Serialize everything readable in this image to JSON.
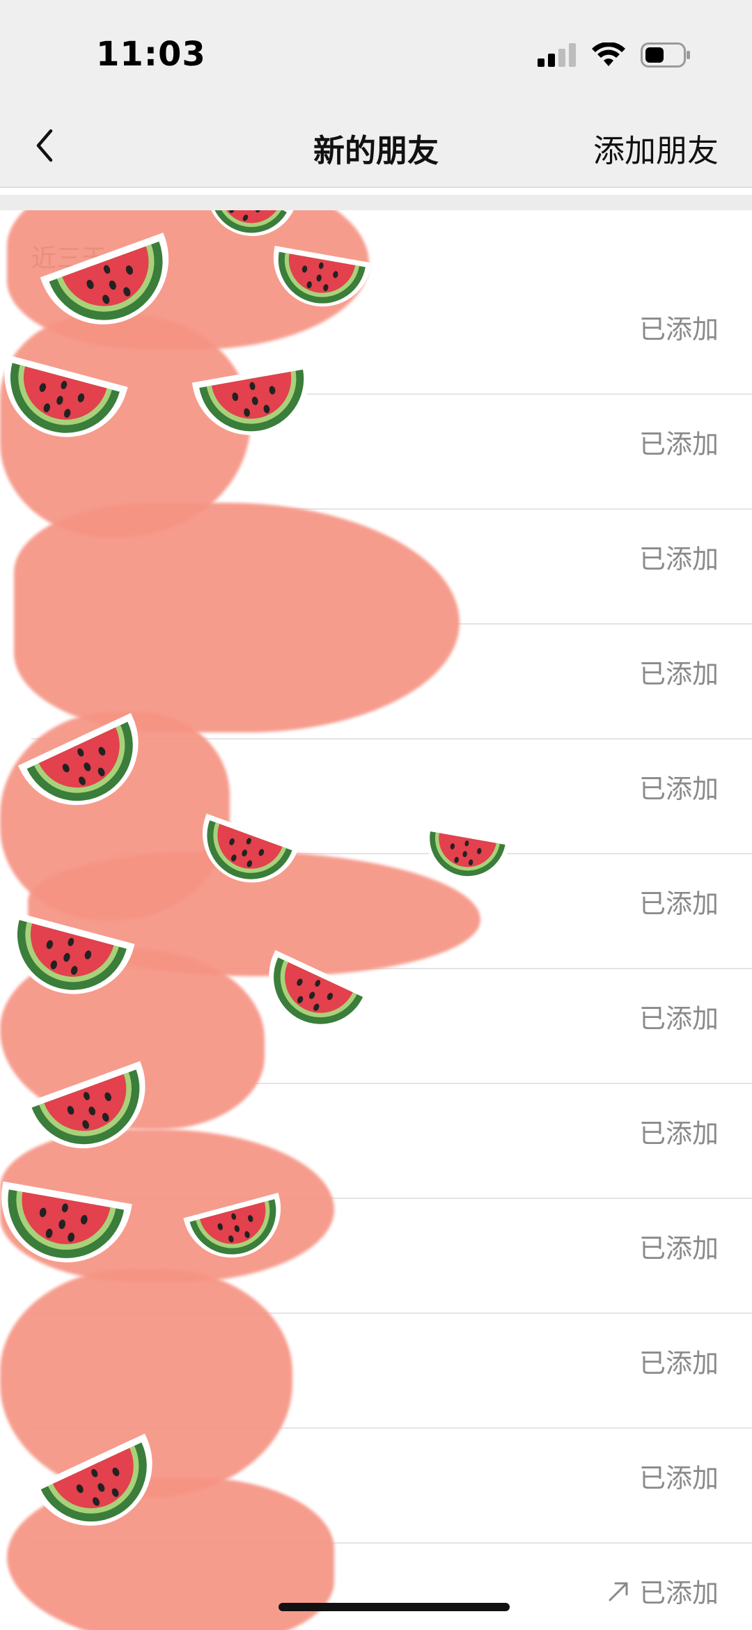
{
  "status_bar": {
    "time": "11:03",
    "icons": [
      "cellular-signal-icon",
      "wifi-icon",
      "battery-icon"
    ]
  },
  "nav": {
    "back_icon": "chevron-left-icon",
    "title": "新的朋友",
    "action_label": "添加朋友"
  },
  "section": {
    "header": "近三天"
  },
  "requests": [
    {
      "status": "已添加"
    },
    {
      "status": "已添加"
    },
    {
      "status": "已添加"
    },
    {
      "status": "已添加"
    },
    {
      "status": "已添加"
    },
    {
      "status": "已添加"
    },
    {
      "status": "已添加"
    },
    {
      "status": "已添加"
    },
    {
      "status": "已添加"
    },
    {
      "status": "已添加"
    },
    {
      "status": "已添加"
    },
    {
      "status": "已添加",
      "status_icon": "arrow-up-right-icon"
    }
  ],
  "colors": {
    "background": "#ffffff",
    "topbar": "#efefef",
    "status_text": "#8a8a8a",
    "watermelon_pink": "#f69484",
    "watermelon_red": "#e2414d",
    "watermelon_green": "#3b7d3a"
  }
}
